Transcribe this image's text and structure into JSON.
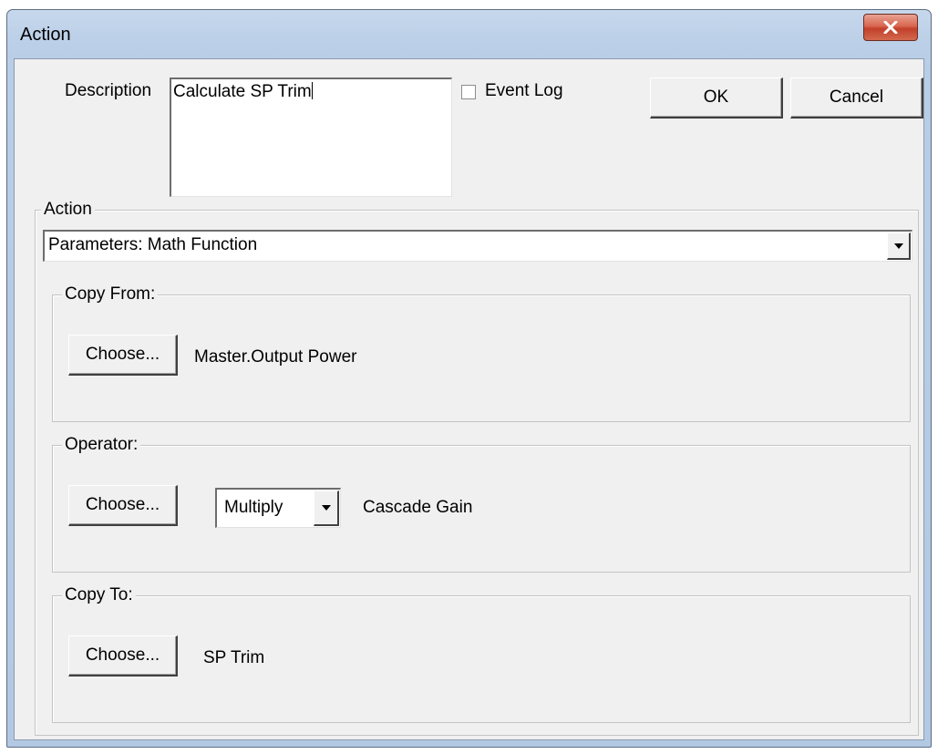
{
  "window": {
    "title": "Action"
  },
  "description": {
    "label": "Description",
    "value": "Calculate SP Trim"
  },
  "event_log": {
    "label": "Event Log",
    "checked": false
  },
  "buttons": {
    "ok": "OK",
    "cancel": "Cancel"
  },
  "action_group": {
    "title": "Action",
    "selected": "Parameters: Math Function"
  },
  "copy_from": {
    "title": "Copy From:",
    "choose_label": "Choose...",
    "value": "Master.Output Power"
  },
  "operator": {
    "title": "Operator:",
    "choose_label": "Choose...",
    "selected": "Multiply",
    "value": "Cascade Gain"
  },
  "copy_to": {
    "title": "Copy To:",
    "choose_label": "Choose...",
    "value": "SP Trim"
  },
  "icons": {
    "close": "close-icon",
    "dropdown": "chevron-down-icon"
  }
}
